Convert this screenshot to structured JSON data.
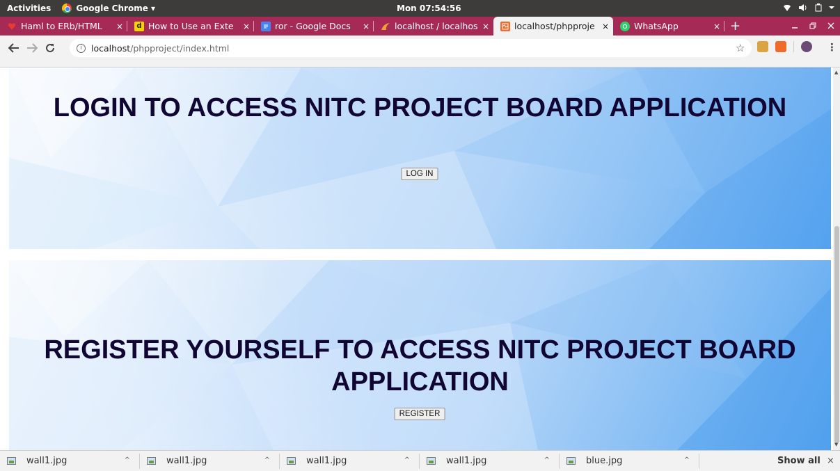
{
  "system_bar": {
    "activities": "Activities",
    "app_name": "Google Chrome ▾",
    "clock": "Mon 07:54:56"
  },
  "tabs": [
    {
      "title": "Haml to ERb/HTML",
      "favicon": "heart-icon",
      "active": false
    },
    {
      "title": "How to Use an Exte",
      "favicon": "d-letter-icon",
      "active": false
    },
    {
      "title": "ror - Google Docs",
      "favicon": "docs-icon",
      "active": false
    },
    {
      "title": "localhost / localhos",
      "favicon": "phpmyadmin-icon",
      "active": false
    },
    {
      "title": "localhost/phpproje",
      "favicon": "broken-page-icon",
      "active": true
    },
    {
      "title": "WhatsApp",
      "favicon": "whatsapp-icon",
      "active": false
    }
  ],
  "tab_close_glyph": "×",
  "new_tab_glyph": "+",
  "address_bar": {
    "host": "localhost",
    "path": "/phpproject/index.html"
  },
  "page": {
    "login_heading": "LOGIN TO ACCESS NITC PROJECT BOARD APPLICATION",
    "login_button": "LOG IN",
    "register_heading": "REGISTER YOURSELF TO ACCESS NITC PROJECT BOARD APPLICATION",
    "register_button": "REGISTER"
  },
  "downloads": [
    {
      "filename": "wall1.jpg"
    },
    {
      "filename": "wall1.jpg"
    },
    {
      "filename": "wall1.jpg"
    },
    {
      "filename": "wall1.jpg"
    },
    {
      "filename": "blue.jpg"
    }
  ],
  "download_shelf": {
    "show_all": "Show all",
    "close": "×"
  },
  "colors": {
    "tab_strip": "#a52a55",
    "heading_text": "#110633",
    "panel_blue": "#5aa6f0"
  }
}
